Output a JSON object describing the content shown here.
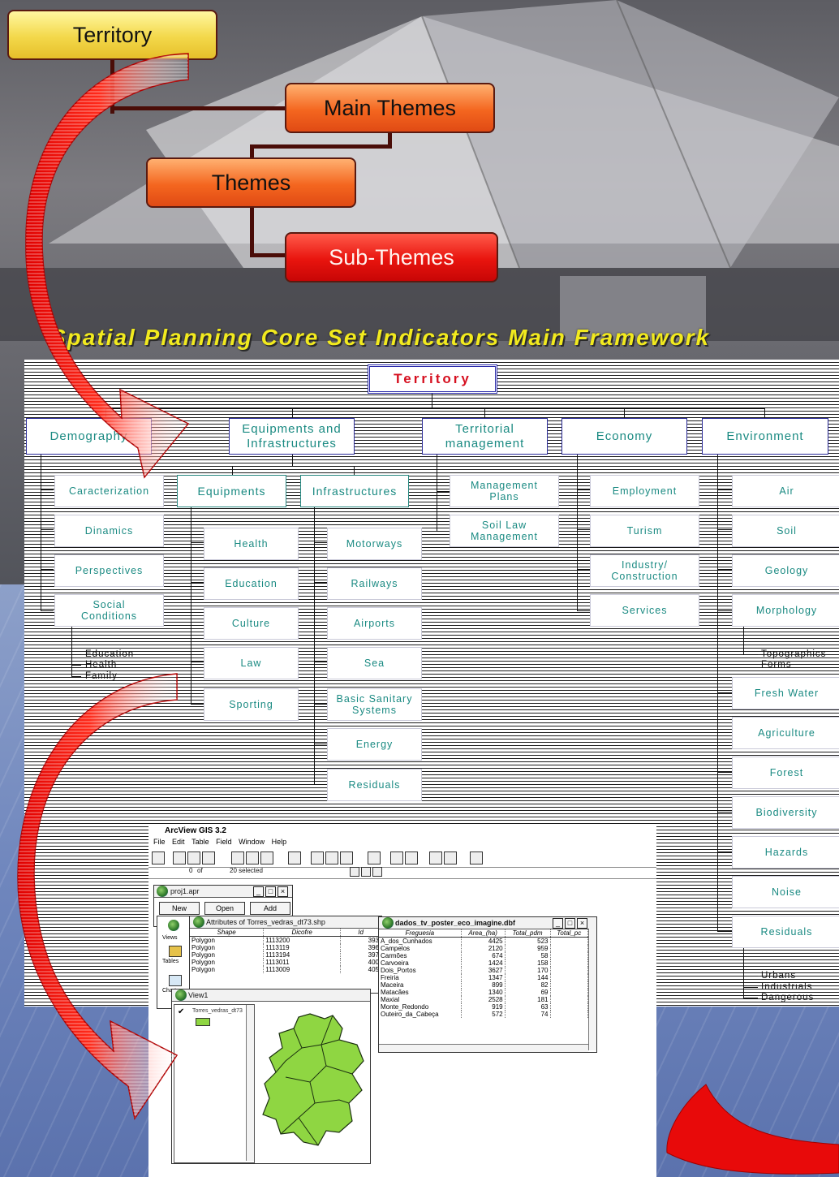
{
  "hierarchy": {
    "territory": "Territory",
    "main_themes": "Main Themes",
    "themes": "Themes",
    "sub_themes": "Sub-Themes"
  },
  "title": "Spatial Planning Core Set Indicators Main Framework",
  "framework": {
    "root": "Territory",
    "categories": {
      "demography": "Demography",
      "equipments": "Equipments and Infrastructures",
      "territorial": "Territorial management",
      "economy": "Economy",
      "environment": "Environment"
    },
    "demography_items": [
      "Caracterization",
      "Dinamics",
      "Perspectives",
      "Social Conditions"
    ],
    "social_sub": [
      "Education",
      "Health",
      "Family"
    ],
    "equip_groups": {
      "equipments": "Equipments",
      "infrastructures": "Infrastructures"
    },
    "equipments_items": [
      "Health",
      "Education",
      "Culture",
      "Law",
      "Sporting"
    ],
    "infrastructures_items": [
      "Motorways",
      "Railways",
      "Airports",
      "Sea",
      "Basic Sanitary Systems",
      "Energy",
      "Residuals"
    ],
    "territorial_items": [
      "Management Plans",
      "Soil Law Management"
    ],
    "economy_items": [
      "Employment",
      "Turism",
      "Industry/ Construction",
      "Services"
    ],
    "environment_items": [
      "Air",
      "Soil",
      "Geology",
      "Morphology",
      "Fresh Water",
      "Agriculture",
      "Forest",
      "Biodiversity",
      "Hazards",
      "Noise",
      "Residuals"
    ],
    "morphology_sub": "Topographics Forms",
    "residuals_sub": [
      "Urbans",
      "Industrials",
      "Dangerous"
    ]
  },
  "arcview": {
    "app_title": "ArcView GIS 3.2",
    "menu": [
      "File",
      "Edit",
      "Table",
      "Field",
      "Window",
      "Help"
    ],
    "selected_count": "0",
    "of_label": "of",
    "total_selected": "20 selected",
    "project_title": "proj1.apr",
    "project_buttons": [
      "New",
      "Open",
      "Add"
    ],
    "project_items": [
      "Views",
      "Tables",
      "Charts"
    ],
    "attr_title": "Attributes of Torres_vedras_dt73.shp",
    "attr_columns": [
      "Shape",
      "Dicofre",
      "Id"
    ],
    "attr_rows": [
      [
        "Polygon",
        "1113200",
        "393"
      ],
      [
        "Polygon",
        "1113119",
        "396"
      ],
      [
        "Polygon",
        "1113194",
        "397"
      ],
      [
        "Polygon",
        "1113011",
        "400"
      ],
      [
        "Polygon",
        "1113009",
        "405"
      ]
    ],
    "view_title": "View1",
    "legend_layer": "Torres_vedras_dt73",
    "dbf_title": "dados_tv_poster_eco_imagine.dbf",
    "dbf_columns": [
      "Freguesia",
      "Area_(ha)",
      "Total_pdm",
      "Total_pc"
    ],
    "dbf_rows": [
      [
        "A_dos_Cunhados",
        "4425",
        "523"
      ],
      [
        "Campelos",
        "2120",
        "959"
      ],
      [
        "Carmões",
        "674",
        "58"
      ],
      [
        "Carvoeira",
        "1424",
        "158"
      ],
      [
        "Dois_Portos",
        "3627",
        "170"
      ],
      [
        "Freiria",
        "1347",
        "144"
      ],
      [
        "Maceira",
        "899",
        "82"
      ],
      [
        "Matacães",
        "1340",
        "69"
      ],
      [
        "Maxial",
        "2528",
        "181"
      ],
      [
        "Monte_Redondo",
        "919",
        "63"
      ],
      [
        "Outeiro_da_Cabeça",
        "572",
        "74"
      ]
    ]
  },
  "colors": {
    "title_yellow": "#f2ea1e",
    "framework_text": "#1a8a82",
    "root_text": "#d61020",
    "map_green": "#8fd642"
  }
}
